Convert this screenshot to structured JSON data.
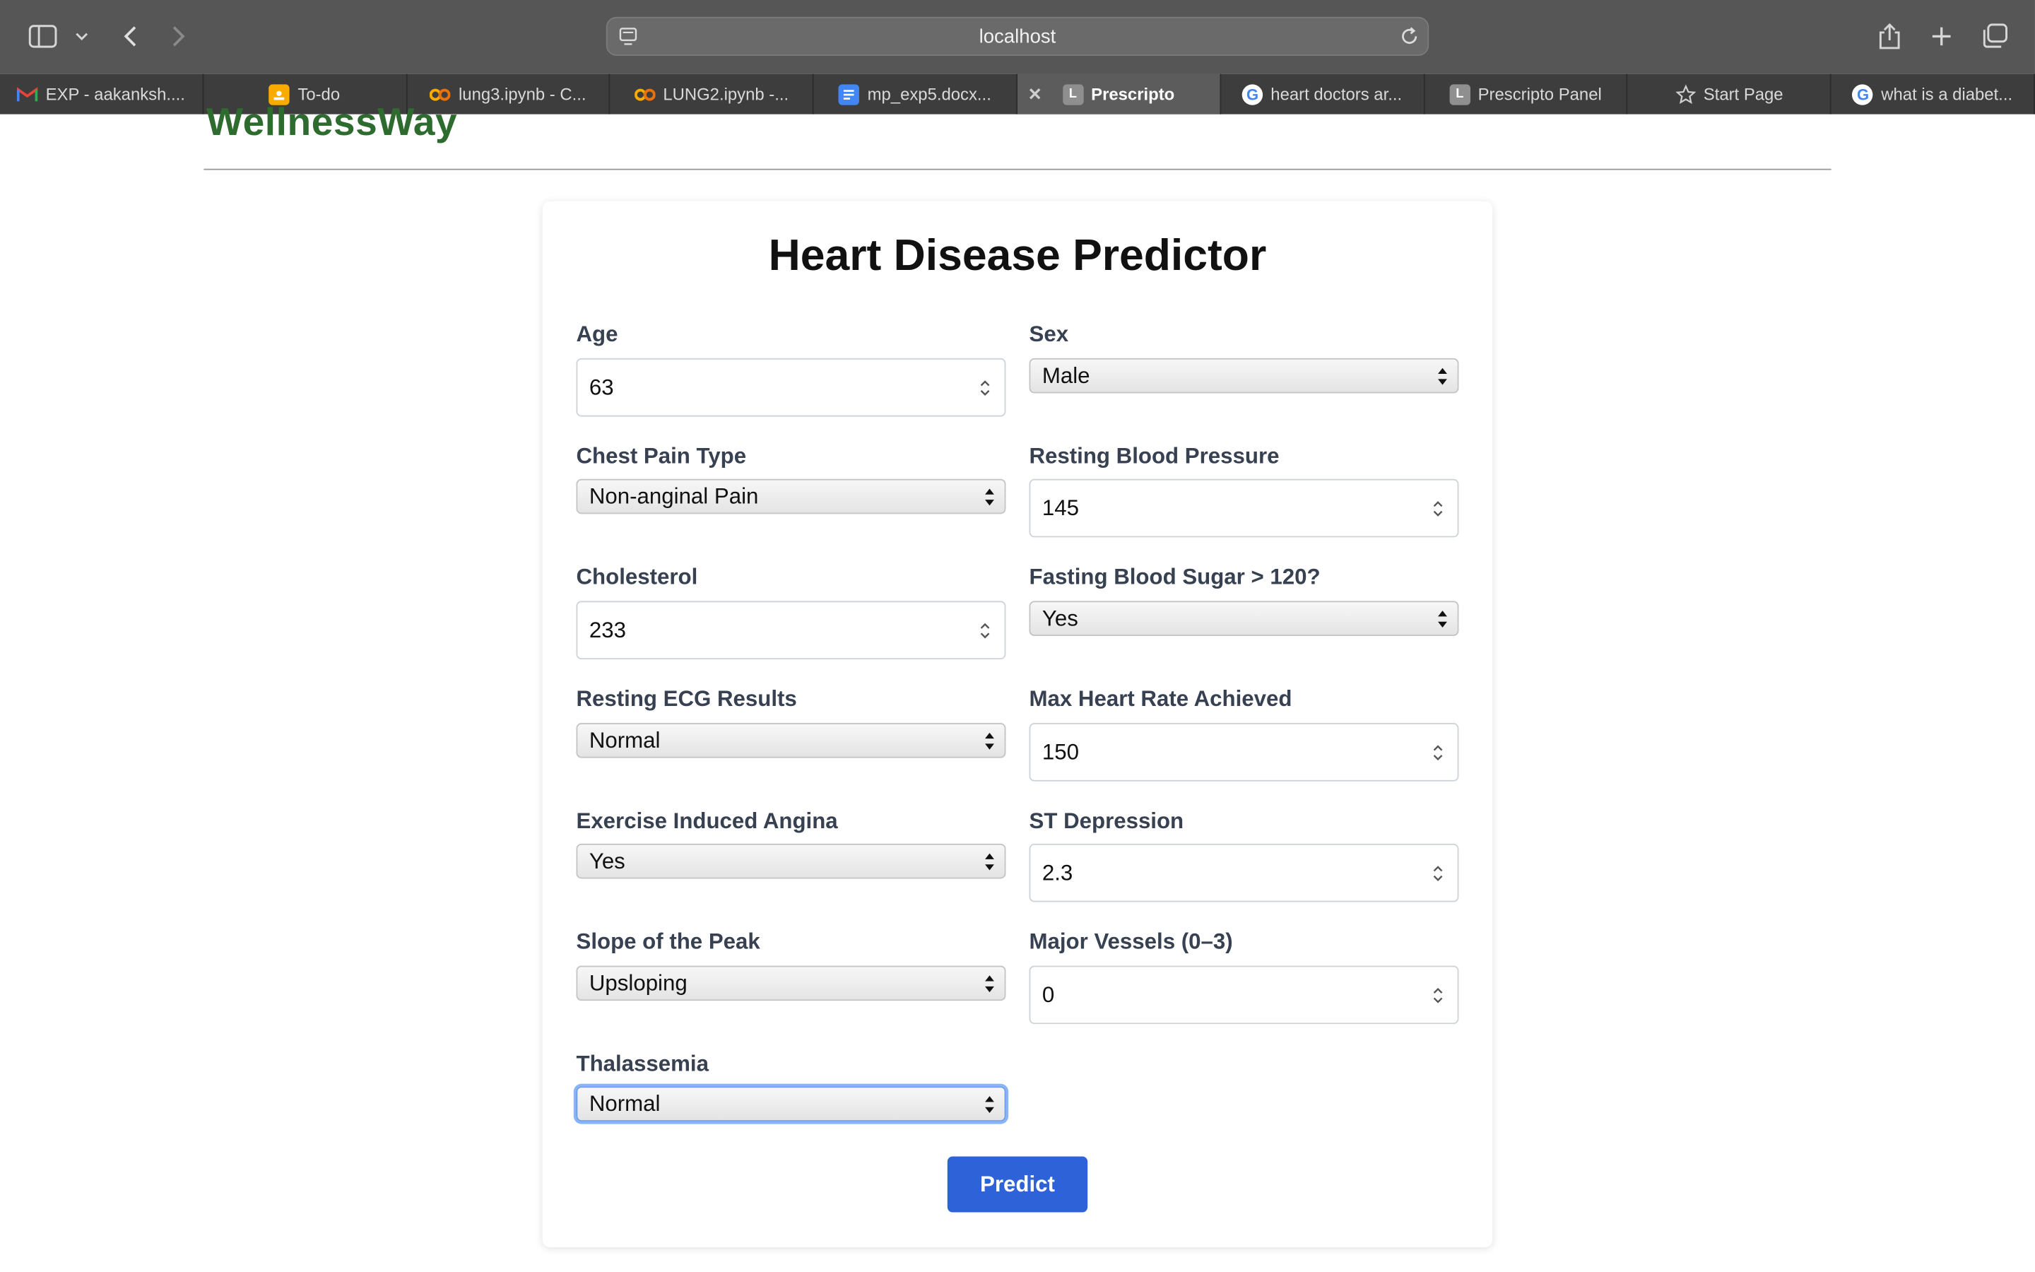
{
  "browser": {
    "address": "localhost",
    "tabs": [
      {
        "label": "EXP - aakanksh....",
        "icon": "gmail-icon"
      },
      {
        "label": "To-do",
        "icon": "classroom-icon"
      },
      {
        "label": "lung3.ipynb - C...",
        "icon": "colab-icon"
      },
      {
        "label": "LUNG2.ipynb -...",
        "icon": "colab-icon"
      },
      {
        "label": "mp_exp5.docx...",
        "icon": "docs-icon"
      },
      {
        "label": "Prescripto",
        "icon": "letter-l-icon",
        "active": true
      },
      {
        "label": "heart doctors ar...",
        "icon": "google-icon"
      },
      {
        "label": "Prescripto Panel",
        "icon": "letter-l-icon"
      },
      {
        "label": "Start Page",
        "icon": "star-icon"
      },
      {
        "label": "what is a diabet...",
        "icon": "google-icon"
      }
    ]
  },
  "site": {
    "brand": "WellnessWay"
  },
  "form": {
    "title": "Heart Disease Predictor",
    "fields": {
      "age": {
        "label": "Age",
        "value": "63"
      },
      "sex": {
        "label": "Sex",
        "value": "Male"
      },
      "chest_pain": {
        "label": "Chest Pain Type",
        "value": "Non-anginal Pain"
      },
      "resting_bp": {
        "label": "Resting Blood Pressure",
        "value": "145"
      },
      "cholesterol": {
        "label": "Cholesterol",
        "value": "233"
      },
      "fasting_sugar": {
        "label": "Fasting Blood Sugar > 120?",
        "value": "Yes"
      },
      "resting_ecg": {
        "label": "Resting ECG Results",
        "value": "Normal"
      },
      "max_hr": {
        "label": "Max Heart Rate Achieved",
        "value": "150"
      },
      "angina": {
        "label": "Exercise Induced Angina",
        "value": "Yes"
      },
      "st_depression": {
        "label": "ST Depression",
        "value": "2.3"
      },
      "slope": {
        "label": "Slope of the Peak",
        "value": "Upsloping"
      },
      "major_vessels": {
        "label": "Major Vessels (0–3)",
        "value": "0"
      },
      "thalassemia": {
        "label": "Thalassemia",
        "value": "Normal"
      }
    },
    "submit_label": "Predict"
  },
  "colors": {
    "brand": "#2e6b2e",
    "button": "#2d62d9",
    "focus_ring": "#8ab4f8"
  }
}
